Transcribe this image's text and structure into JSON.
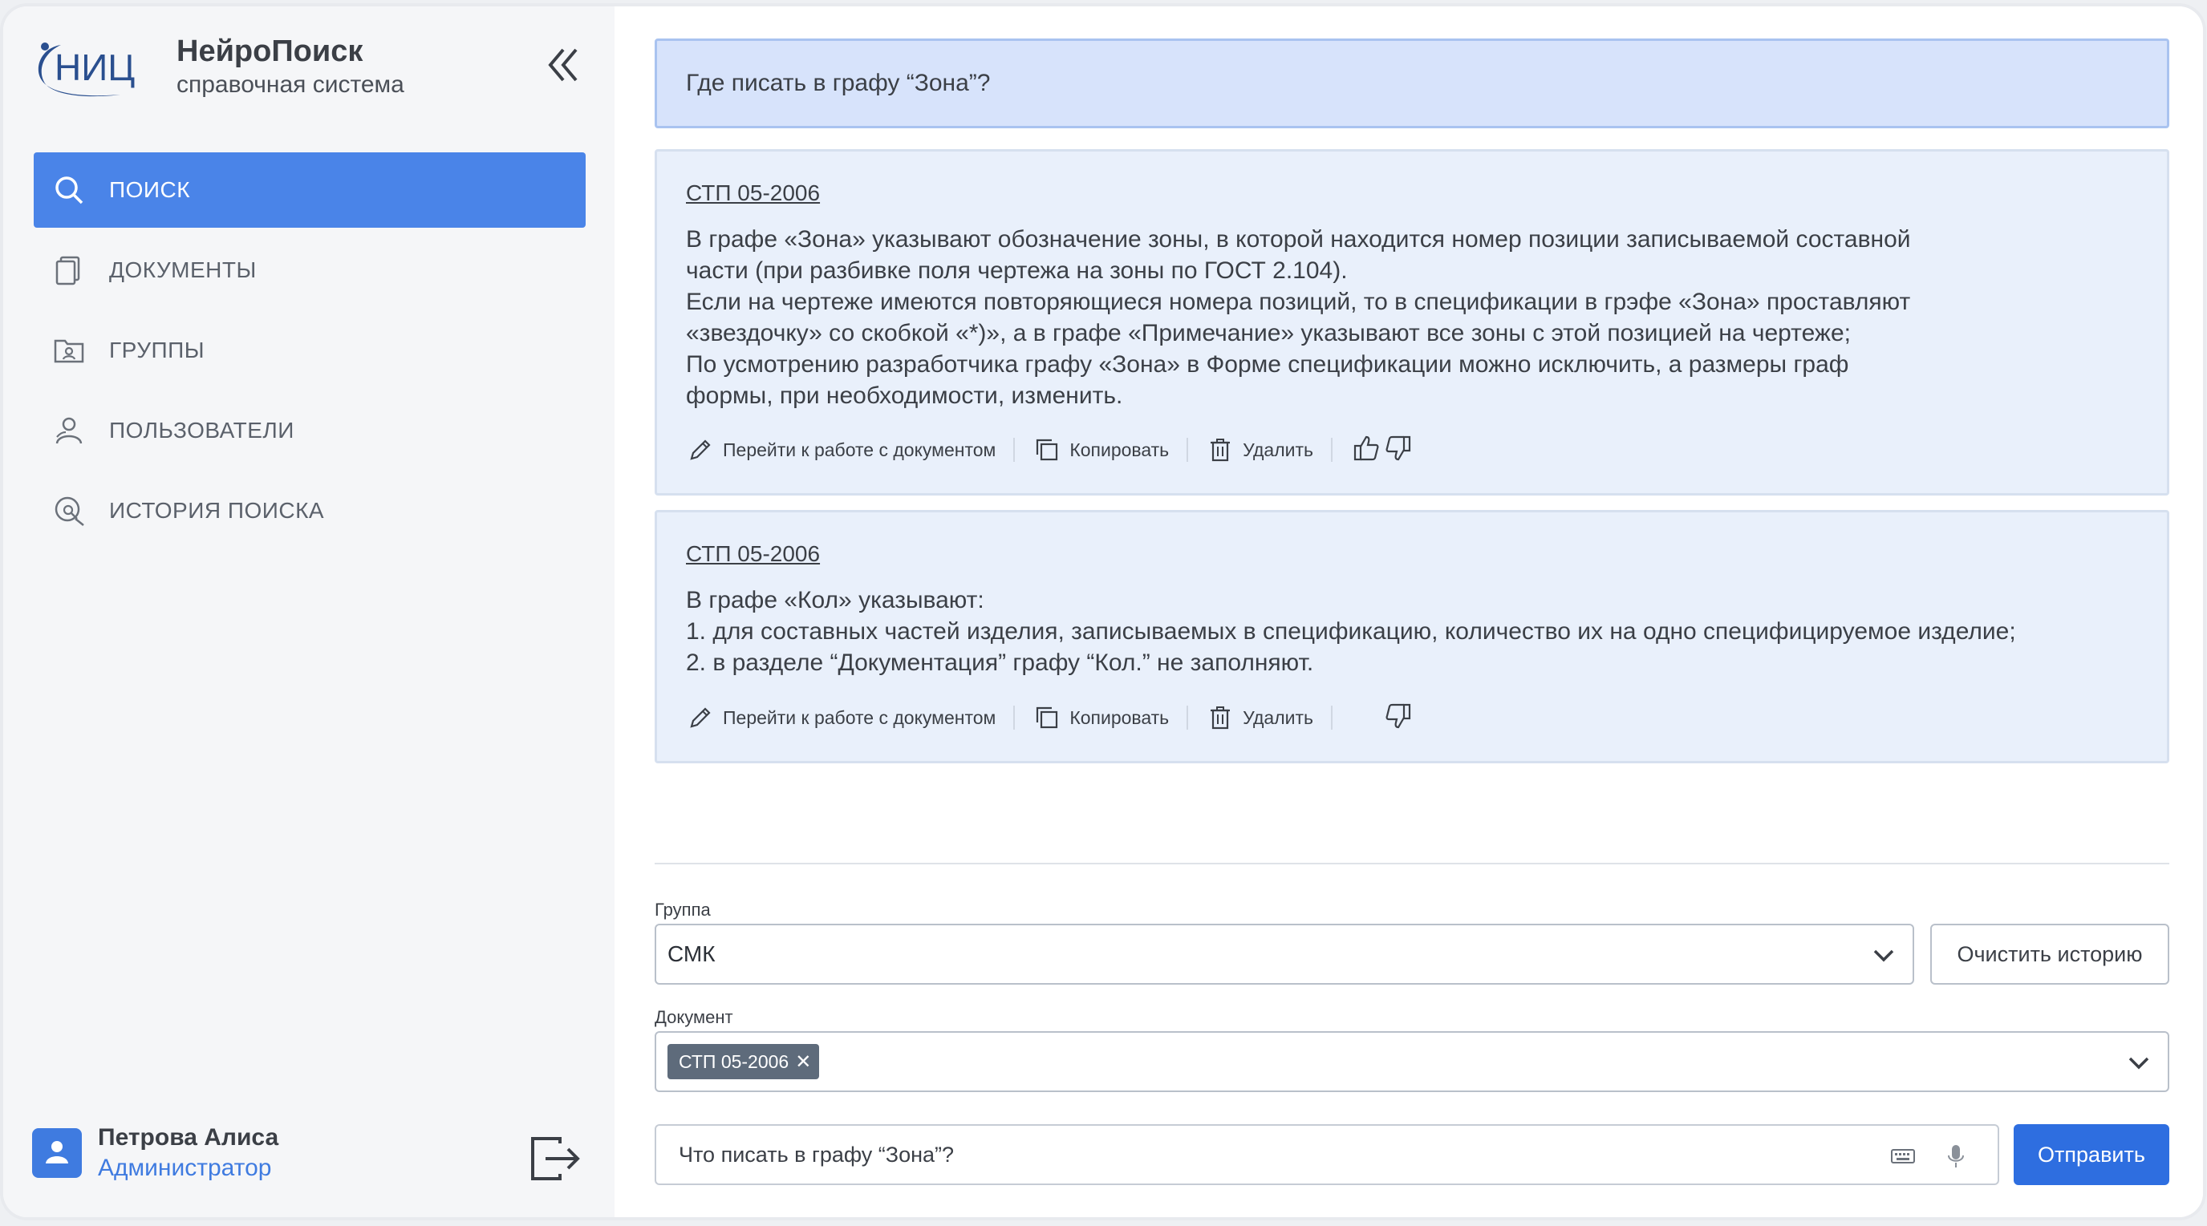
{
  "brand": {
    "logo_text": "НИЦ",
    "title": "НейроПоиск",
    "subtitle": "справочная система"
  },
  "sidebar": {
    "collapse_icon": "double-chevron-left-icon",
    "items": [
      {
        "label": "ПОИСК",
        "icon": "search-icon",
        "active": true
      },
      {
        "label": "ДОКУМЕНТЫ",
        "icon": "documents-icon",
        "active": false
      },
      {
        "label": "ГРУППЫ",
        "icon": "groups-icon",
        "active": false
      },
      {
        "label": "ПОЛЬЗОВАТЕЛИ",
        "icon": "users-icon",
        "active": false
      },
      {
        "label": "ИСТОРИЯ ПОИСКА",
        "icon": "search-history-icon",
        "active": false
      }
    ]
  },
  "user": {
    "name": "Петрова Алиса",
    "role": "Администратор"
  },
  "query": {
    "text": "Где писать в графу “Зона”?"
  },
  "answers": [
    {
      "source": "СТП 05-2006",
      "lines": [
        "В графе «Зона» указывают обозначение зоны, в которой находится номер позиции записываемой составной",
        "части (при разбивке поля чертежа на зоны по ГОСТ 2.104).",
        "Если на чертеже имеются повторяющиеся номера позиций, то в спецификации в грэфе «Зона» проставляют",
        "«звездочку» со скобкой «*)», а в графе «Примечание» указывают все зоны  с этой позицией на чертеже;",
        "По усмотрению разработчика графу «Зона» в Форме спецификации можно исключить, а размеры граф",
        "формы, при необходимости, изменить."
      ]
    },
    {
      "source": "СТП 05-2006",
      "lines": [
        "В графе «Кол» указывают:",
        "1. для составных частей изделия, записываемых в спецификацию, количество их на одно специфицируемое изделие;",
        "2. в разделе “Документация” графу “Кол.” не заполняют."
      ]
    }
  ],
  "actions": {
    "open_doc": "Перейти к работе с документом",
    "copy": "Копировать",
    "delete": "Удалить"
  },
  "filters": {
    "group_label": "Группа",
    "group_value": "СМК",
    "clear_label": "Очистить историю",
    "document_label": "Документ",
    "document_chip": "СТП 05-2006"
  },
  "composer": {
    "value": "Что писать в графу “Зона”?",
    "send_label": "Отправить"
  },
  "colors": {
    "accent": "#4a84e8",
    "send": "#2e6ee0",
    "query_bg": "#d7e3fb",
    "answer_bg": "#e9f0fb"
  }
}
